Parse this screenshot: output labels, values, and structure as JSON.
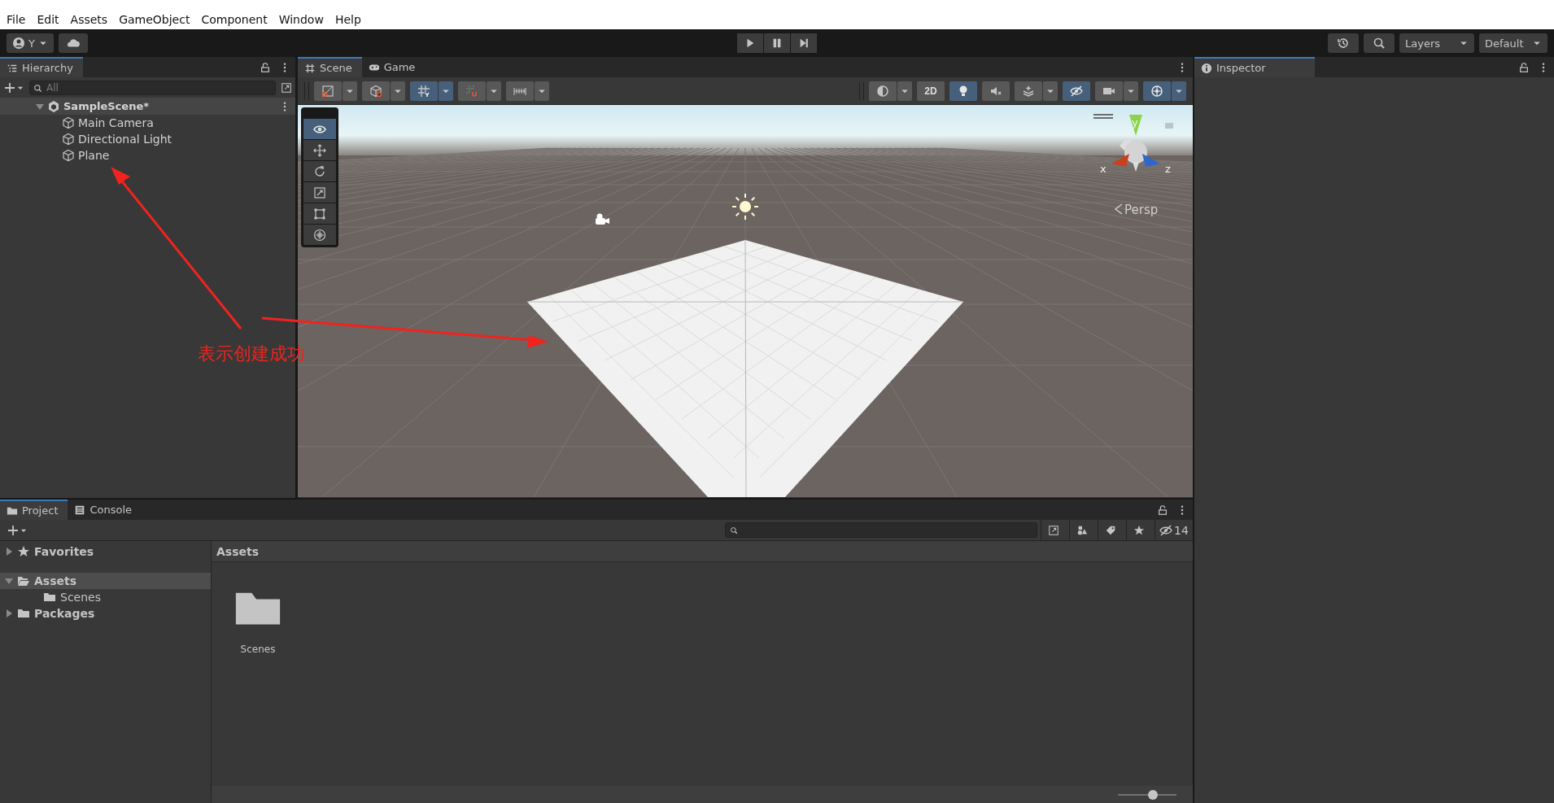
{
  "menu_bar": [
    "File",
    "Edit",
    "Assets",
    "GameObject",
    "Component",
    "Window",
    "Help"
  ],
  "toolbar": {
    "account": "Y",
    "play_controls": [
      {
        "kind": "play",
        "on": false
      },
      {
        "kind": "pause",
        "on": false
      },
      {
        "kind": "step",
        "on": false
      }
    ],
    "layers": "Layers",
    "layout": "Default"
  },
  "hierarchy": {
    "title": "Hierarchy",
    "search_placeholder": "All",
    "scene": {
      "name": "SampleScene*",
      "expanded": true,
      "children": [
        {
          "name": "Main Camera"
        },
        {
          "name": "Directional Light"
        },
        {
          "name": "Plane"
        }
      ]
    }
  },
  "scene_view": {
    "tabs": [
      {
        "label": "Scene",
        "selected": true,
        "kind": "scene"
      },
      {
        "label": "Game",
        "selected": false,
        "kind": "game"
      }
    ],
    "toolbar_left": [
      {
        "kind": "global",
        "on": false
      },
      {
        "kind": "pivot",
        "on": false
      },
      {
        "kind": "grid-snap",
        "on": true
      },
      {
        "kind": "increment-snap",
        "on": false
      },
      {
        "kind": "ruler",
        "on": false
      }
    ],
    "toolbar_right": [
      {
        "kind": "shading",
        "on": false
      },
      {
        "kind": "two-d",
        "label": "2D",
        "on": false
      },
      {
        "kind": "lighting",
        "on": true
      },
      {
        "kind": "audio",
        "on": false
      },
      {
        "kind": "effects",
        "on": false
      },
      {
        "kind": "visibility",
        "on": true
      },
      {
        "kind": "camera",
        "on": false
      },
      {
        "kind": "gizmos",
        "on": true
      }
    ],
    "tools": [
      {
        "kind": "view",
        "selected": true
      },
      {
        "kind": "move",
        "selected": false
      },
      {
        "kind": "rotate",
        "selected": false
      },
      {
        "kind": "scale",
        "selected": false
      },
      {
        "kind": "rect",
        "selected": false
      },
      {
        "kind": "transform",
        "selected": false
      }
    ],
    "gizmo_labels": [
      "y",
      "x",
      "z"
    ],
    "projection": "Persp"
  },
  "inspector": {
    "title": "Inspector"
  },
  "project": {
    "tabs": [
      {
        "label": "Project",
        "selected": true,
        "kind": "project"
      },
      {
        "label": "Console",
        "selected": false,
        "kind": "console"
      }
    ],
    "hidden_count": "14",
    "tree": [
      {
        "label": "Favorites",
        "kind": "favorites",
        "expanded": false,
        "selected": false
      },
      {
        "label": "Assets",
        "kind": "folder",
        "expanded": true,
        "selected": true,
        "children": [
          {
            "label": "Scenes",
            "kind": "folder",
            "selected": false
          }
        ]
      },
      {
        "label": "Packages",
        "kind": "folder",
        "expanded": false,
        "selected": false
      }
    ],
    "breadcrumb": "Assets",
    "items": [
      {
        "label": "Scenes",
        "kind": "folder"
      }
    ],
    "zoom_slider": {
      "level": 0.6
    }
  },
  "annotation": {
    "text": "表示创建成功"
  }
}
